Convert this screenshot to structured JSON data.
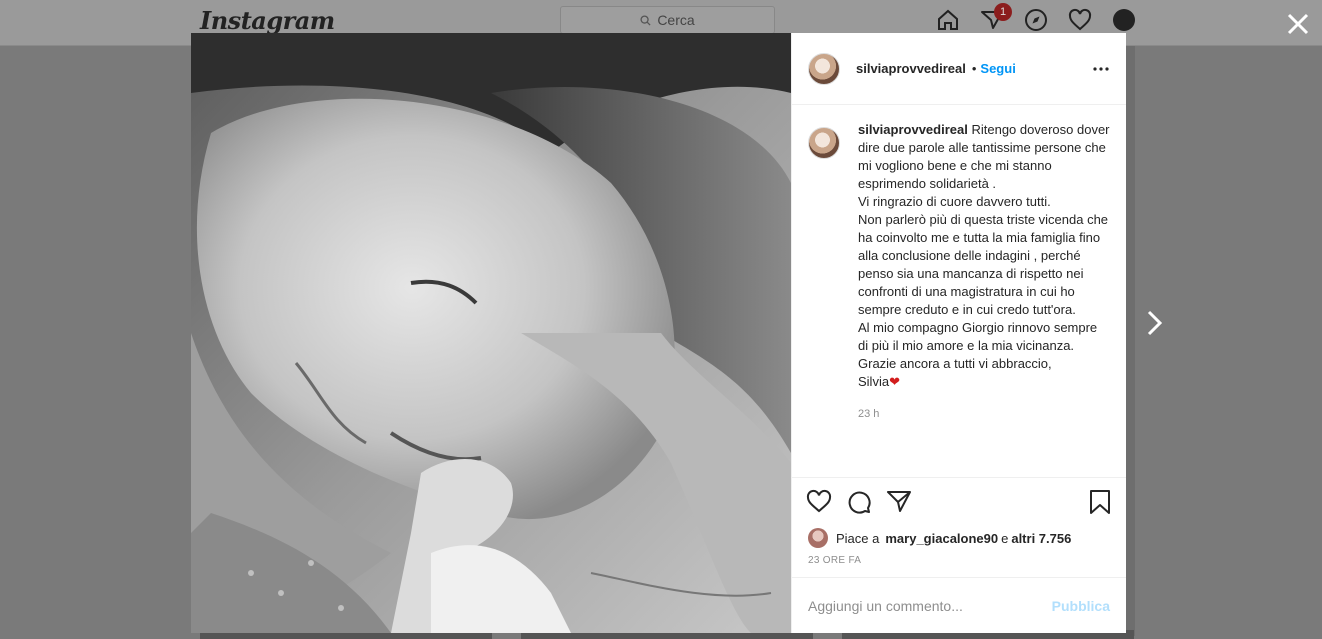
{
  "app": {
    "logo": "Instagram"
  },
  "topbar": {
    "search_placeholder": "Cerca",
    "notification_count": "1"
  },
  "post": {
    "username": "silviaprovvedireal",
    "separator": "•",
    "follow_label": "Segui",
    "caption": {
      "username": "silviaprovvedireal",
      "text": "Ritengo doveroso dover dire due parole alle tantissime persone che mi vogliono bene e che mi stanno esprimendo solidarietà .\nVi ringrazio di cuore davvero tutti.\nNon parlerò più di questa triste vicenda che ha coinvolto me e tutta la mia famiglia fino alla conclusione delle indagini , perché penso sia una mancanza di rispetto nei confronti di una magistratura in cui ho sempre creduto e in cui credo tutt'ora.\nAl mio compagno Giorgio rinnovo sempre di più il mio amore e la mia vicinanza.\nGrazie ancora a tutti vi abbraccio,\nSilvia",
      "emoji": "❤",
      "time": "23 h"
    },
    "likes": {
      "prefix": "Piace a",
      "user": "mary_giacalone90",
      "conj": "e",
      "others": "altri 7.756"
    },
    "date": "23 ORE FA",
    "comment": {
      "placeholder": "Aggiungi un commento...",
      "publish_label": "Pubblica"
    }
  }
}
